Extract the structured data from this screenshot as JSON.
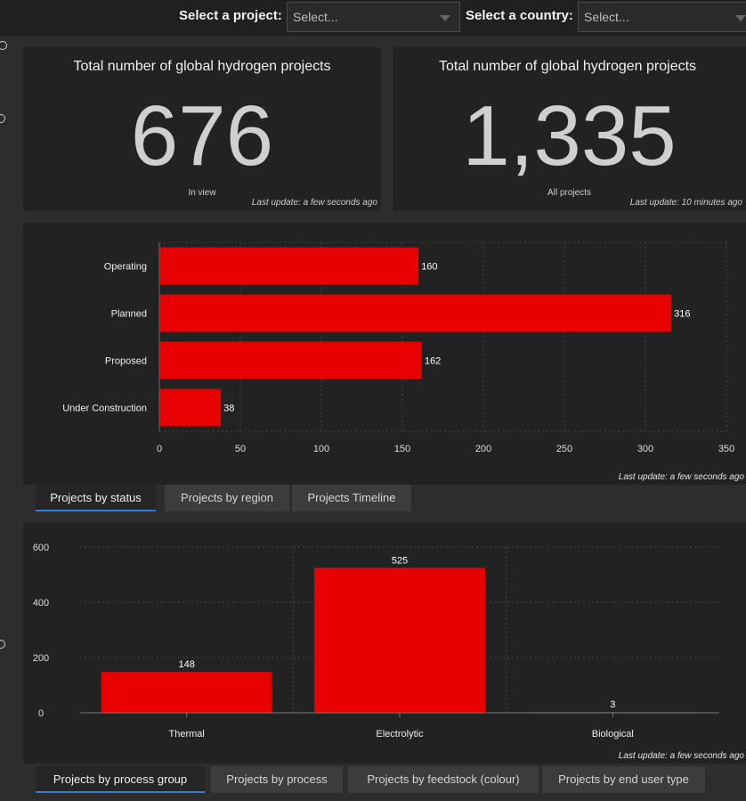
{
  "header": {
    "project_label": "Select a project:",
    "project_value": "Select...",
    "country_label": "Select a country:",
    "country_value": "Select..."
  },
  "kpis": [
    {
      "title": "Total number of global hydrogen projects",
      "value": "676",
      "subtitle": "In view",
      "last_update": "Last update: a few seconds ago"
    },
    {
      "title": "Total number of global hydrogen projects",
      "value": "1,335",
      "subtitle": "All projects",
      "last_update": "Last update: 10 minutes ago"
    }
  ],
  "status_panel": {
    "last_update": "Last update: a few seconds ago",
    "tabs": [
      "Projects by status",
      "Projects by region",
      "Projects Timeline"
    ],
    "active_tab": 0
  },
  "process_panel": {
    "last_update": "Last update: a few seconds ago",
    "tabs": [
      "Projects by process group",
      "Projects by process",
      "Projects by feedstock (colour)",
      "Projects by end user type"
    ],
    "active_tab": 0
  },
  "colors": {
    "bar": "#e60000",
    "panel": "#222222",
    "accent": "#2f7fd6"
  },
  "chart_data": [
    {
      "type": "bar",
      "orientation": "horizontal",
      "categories": [
        "Operating",
        "Planned",
        "Proposed",
        "Under Construction"
      ],
      "values": [
        160,
        316,
        162,
        38
      ],
      "xticks": [
        0,
        50,
        100,
        150,
        200,
        250,
        300,
        350
      ],
      "xlim": [
        0,
        350
      ],
      "grid": true
    },
    {
      "type": "bar",
      "orientation": "vertical",
      "categories": [
        "Thermal",
        "Electrolytic",
        "Biological"
      ],
      "values": [
        148,
        525,
        3
      ],
      "yticks": [
        0,
        200,
        400,
        600
      ],
      "ylim": [
        0,
        600
      ],
      "grid": true
    }
  ]
}
